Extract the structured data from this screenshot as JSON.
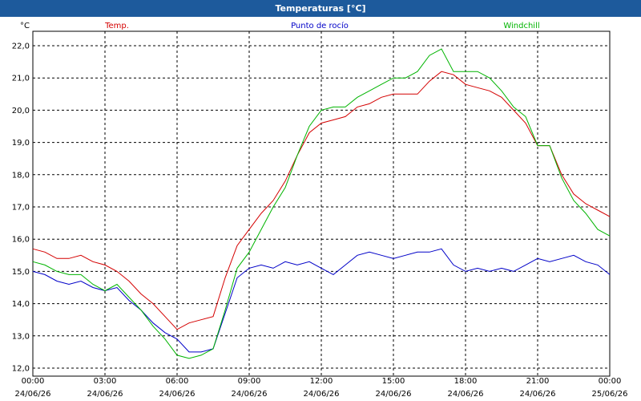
{
  "window": {
    "title": "Temperaturas [°C]"
  },
  "chart_data": {
    "type": "line",
    "title": "Temperaturas [°C]",
    "ylabel": "°C",
    "ylim": [
      12,
      22
    ],
    "y_ticks": [
      "12,0",
      "13,0",
      "14,0",
      "15,0",
      "16,0",
      "17,0",
      "18,0",
      "19,0",
      "20,0",
      "21,0",
      "22,0"
    ],
    "x_ticks": [
      {
        "time": "00:00",
        "date": "24/06/26"
      },
      {
        "time": "03:00",
        "date": "24/06/26"
      },
      {
        "time": "06:00",
        "date": "24/06/26"
      },
      {
        "time": "09:00",
        "date": "24/06/26"
      },
      {
        "time": "12:00",
        "date": "24/06/26"
      },
      {
        "time": "15:00",
        "date": "24/06/26"
      },
      {
        "time": "18:00",
        "date": "24/06/26"
      },
      {
        "time": "21:00",
        "date": "24/06/26"
      },
      {
        "time": "00:00",
        "date": "25/06/26"
      }
    ],
    "x_hours": [
      0,
      0.5,
      1,
      1.5,
      2,
      2.5,
      3,
      3.5,
      4,
      4.5,
      5,
      5.5,
      6,
      6.5,
      7,
      7.5,
      8,
      8.5,
      9,
      9.5,
      10,
      10.5,
      11,
      11.5,
      12,
      12.5,
      13,
      13.5,
      14,
      14.5,
      15,
      15.5,
      16,
      16.5,
      17,
      17.5,
      18,
      18.5,
      19,
      19.5,
      20,
      20.5,
      21,
      21.5,
      22,
      22.5,
      23,
      23.5,
      24
    ],
    "grid": true,
    "series": [
      {
        "name": "Temp.",
        "color": "#d40000",
        "values": [
          15.7,
          15.6,
          15.4,
          15.4,
          15.5,
          15.3,
          15.2,
          15.0,
          14.7,
          14.3,
          14.0,
          13.6,
          13.2,
          13.4,
          13.5,
          13.6,
          14.8,
          15.8,
          16.3,
          16.8,
          17.2,
          17.8,
          18.6,
          19.3,
          19.6,
          19.7,
          19.8,
          20.1,
          20.2,
          20.4,
          20.5,
          20.5,
          20.5,
          20.9,
          21.2,
          21.1,
          20.8,
          20.7,
          20.6,
          20.4,
          20.0,
          19.6,
          18.9,
          18.9,
          18.0,
          17.4,
          17.1,
          16.9,
          16.7
        ]
      },
      {
        "name": "Punto de rocío",
        "color": "#0000c8",
        "values": [
          15.0,
          14.9,
          14.7,
          14.6,
          14.7,
          14.5,
          14.4,
          14.5,
          14.1,
          13.8,
          13.4,
          13.1,
          12.9,
          12.5,
          12.5,
          12.6,
          13.7,
          14.8,
          15.1,
          15.2,
          15.1,
          15.3,
          15.2,
          15.3,
          15.1,
          14.9,
          15.2,
          15.5,
          15.6,
          15.5,
          15.4,
          15.5,
          15.6,
          15.6,
          15.7,
          15.2,
          15.0,
          15.1,
          15.0,
          15.1,
          15.0,
          15.2,
          15.4,
          15.3,
          15.4,
          15.5,
          15.3,
          15.2,
          14.9
        ]
      },
      {
        "name": "Windchill",
        "color": "#00b400",
        "values": [
          15.3,
          15.2,
          15.0,
          14.9,
          14.9,
          14.6,
          14.4,
          14.6,
          14.2,
          13.8,
          13.3,
          12.9,
          12.4,
          12.3,
          12.4,
          12.6,
          13.8,
          15.1,
          15.6,
          16.3,
          17.0,
          17.6,
          18.6,
          19.5,
          20.0,
          20.1,
          20.1,
          20.4,
          20.6,
          20.8,
          21.0,
          21.0,
          21.2,
          21.7,
          21.9,
          21.2,
          21.2,
          21.2,
          21.0,
          20.6,
          20.1,
          19.8,
          18.9,
          18.9,
          17.9,
          17.2,
          16.8,
          16.3,
          16.1
        ]
      }
    ]
  }
}
